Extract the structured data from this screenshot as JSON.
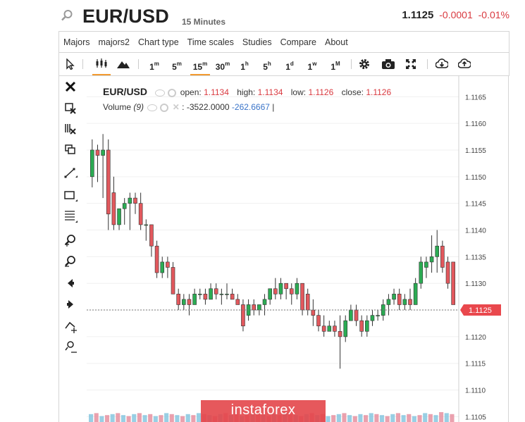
{
  "header": {
    "symbol": "EUR/USD",
    "interval": "15 Minutes",
    "price": "1.1125",
    "change": "-0.0001",
    "change_pct": "-0.01%"
  },
  "menu": [
    "Majors",
    "majors2",
    "Chart type",
    "Time scales",
    "Studies",
    "Compare",
    "About"
  ],
  "toolbar": {
    "periods": [
      {
        "n": "1",
        "u": "m",
        "active": false
      },
      {
        "n": "5",
        "u": "m",
        "active": false
      },
      {
        "n": "15",
        "u": "m",
        "active": true
      },
      {
        "n": "30",
        "u": "m",
        "active": false
      },
      {
        "n": "1",
        "u": "h",
        "active": false
      },
      {
        "n": "5",
        "u": "h",
        "active": false
      },
      {
        "n": "1",
        "u": "d",
        "active": false
      },
      {
        "n": "1",
        "u": "w",
        "active": false
      },
      {
        "n": "1",
        "u": "M",
        "active": false
      }
    ],
    "icons": [
      "cursor-icon",
      "candlestick-icon",
      "mountain-icon",
      "gear-icon",
      "camera-icon",
      "fullscreen-icon",
      "download-icon",
      "upload-icon"
    ]
  },
  "sidebar_icons": [
    "close-icon",
    "delete-drawing-icon",
    "delete-all-icon",
    "clone-icon",
    "trendline-icon",
    "rectangle-icon",
    "fib-icon",
    "zoom-in-icon",
    "zoom-out-icon",
    "scroll-left-icon",
    "scroll-right-icon",
    "magnet-down-icon",
    "magnet-up-icon"
  ],
  "legend": {
    "symbol": "EUR/USD",
    "open_label": "open:",
    "open": "1.1134",
    "high_label": "high:",
    "high": "1.1134",
    "low_label": "low:",
    "low": "1.1126",
    "close_label": "close:",
    "close": "1.1126",
    "volume_label": "Volume",
    "volume_param": "(9)",
    "volume_sep": ":",
    "volume_val1": "-3522.0000",
    "volume_val2": "-262.6667",
    "volume_cursor": "|"
  },
  "watermark": "instaforex",
  "colors": {
    "up": "#2bab53",
    "down": "#e2585d",
    "last": "#e9484d"
  },
  "chart_data": {
    "type": "candlestick",
    "y_ticks": [
      "1.1165",
      "1.1160",
      "1.1155",
      "1.1150",
      "1.1145",
      "1.1140",
      "1.1135",
      "1.1130",
      "1.1125",
      "1.1120",
      "1.1115",
      "1.1110",
      "1.1105"
    ],
    "ylim": [
      1.1104,
      1.1169
    ],
    "last_price": "1.1125",
    "grid": true,
    "candles": [
      {
        "o": 1.115,
        "h": 1.1157,
        "l": 1.1148,
        "c": 1.1155
      },
      {
        "o": 1.1155,
        "h": 1.1156,
        "l": 1.1149,
        "c": 1.1154
      },
      {
        "o": 1.1154,
        "h": 1.1158,
        "l": 1.1146,
        "c": 1.1155
      },
      {
        "o": 1.1155,
        "h": 1.1157,
        "l": 1.114,
        "c": 1.1143
      },
      {
        "o": 1.1147,
        "h": 1.115,
        "l": 1.114,
        "c": 1.1141
      },
      {
        "o": 1.1141,
        "h": 1.1144,
        "l": 1.114,
        "c": 1.1144
      },
      {
        "o": 1.1144,
        "h": 1.1146,
        "l": 1.1141,
        "c": 1.1145
      },
      {
        "o": 1.1145,
        "h": 1.1147,
        "l": 1.114,
        "c": 1.1146
      },
      {
        "o": 1.1146,
        "h": 1.1147,
        "l": 1.1143,
        "c": 1.1145
      },
      {
        "o": 1.1145,
        "h": 1.1147,
        "l": 1.114,
        "c": 1.1141
      },
      {
        "o": 1.1141,
        "h": 1.1142,
        "l": 1.1138,
        "c": 1.1141
      },
      {
        "o": 1.1141,
        "h": 1.1141,
        "l": 1.1135,
        "c": 1.1137
      },
      {
        "o": 1.1137,
        "h": 1.1138,
        "l": 1.1131,
        "c": 1.1132
      },
      {
        "o": 1.1132,
        "h": 1.1135,
        "l": 1.1131,
        "c": 1.1134
      },
      {
        "o": 1.1134,
        "h": 1.1135,
        "l": 1.1131,
        "c": 1.1133
      },
      {
        "o": 1.1133,
        "h": 1.1134,
        "l": 1.1128,
        "c": 1.1128
      },
      {
        "o": 1.1128,
        "h": 1.1129,
        "l": 1.1125,
        "c": 1.1126
      },
      {
        "o": 1.1126,
        "h": 1.1128,
        "l": 1.1125,
        "c": 1.1127
      },
      {
        "o": 1.1127,
        "h": 1.1128,
        "l": 1.1124,
        "c": 1.1126
      },
      {
        "o": 1.1126,
        "h": 1.1129,
        "l": 1.1126,
        "c": 1.1128
      },
      {
        "o": 1.1128,
        "h": 1.1129,
        "l": 1.1127,
        "c": 1.1128
      },
      {
        "o": 1.1128,
        "h": 1.1129,
        "l": 1.1126,
        "c": 1.1127
      },
      {
        "o": 1.1127,
        "h": 1.113,
        "l": 1.1127,
        "c": 1.1129
      },
      {
        "o": 1.1129,
        "h": 1.113,
        "l": 1.1127,
        "c": 1.1128
      },
      {
        "o": 1.1128,
        "h": 1.1129,
        "l": 1.1126,
        "c": 1.1128
      },
      {
        "o": 1.1128,
        "h": 1.113,
        "l": 1.1127,
        "c": 1.1128
      },
      {
        "o": 1.1128,
        "h": 1.1129,
        "l": 1.1127,
        "c": 1.1127
      },
      {
        "o": 1.1127,
        "h": 1.1128,
        "l": 1.1126,
        "c": 1.1126
      },
      {
        "o": 1.1126,
        "h": 1.1127,
        "l": 1.1121,
        "c": 1.1122
      },
      {
        "o": 1.1124,
        "h": 1.1127,
        "l": 1.1123,
        "c": 1.1126
      },
      {
        "o": 1.1126,
        "h": 1.1127,
        "l": 1.1124,
        "c": 1.1125
      },
      {
        "o": 1.1125,
        "h": 1.1126,
        "l": 1.1124,
        "c": 1.1126
      },
      {
        "o": 1.1126,
        "h": 1.1128,
        "l": 1.1124,
        "c": 1.1127
      },
      {
        "o": 1.1127,
        "h": 1.1129,
        "l": 1.1126,
        "c": 1.1129
      },
      {
        "o": 1.1129,
        "h": 1.1131,
        "l": 1.1127,
        "c": 1.1128
      },
      {
        "o": 1.1128,
        "h": 1.1131,
        "l": 1.1127,
        "c": 1.113
      },
      {
        "o": 1.113,
        "h": 1.113,
        "l": 1.1127,
        "c": 1.1129
      },
      {
        "o": 1.1129,
        "h": 1.113,
        "l": 1.1126,
        "c": 1.1128
      },
      {
        "o": 1.1128,
        "h": 1.1131,
        "l": 1.1127,
        "c": 1.113
      },
      {
        "o": 1.113,
        "h": 1.113,
        "l": 1.1124,
        "c": 1.1125
      },
      {
        "o": 1.1128,
        "h": 1.1129,
        "l": 1.1124,
        "c": 1.1125
      },
      {
        "o": 1.1125,
        "h": 1.1127,
        "l": 1.1122,
        "c": 1.1124
      },
      {
        "o": 1.1124,
        "h": 1.1125,
        "l": 1.1121,
        "c": 1.1122
      },
      {
        "o": 1.1122,
        "h": 1.1124,
        "l": 1.112,
        "c": 1.1121
      },
      {
        "o": 1.1121,
        "h": 1.1123,
        "l": 1.1121,
        "c": 1.1122
      },
      {
        "o": 1.1122,
        "h": 1.1123,
        "l": 1.112,
        "c": 1.1121
      },
      {
        "o": 1.1121,
        "h": 1.1124,
        "l": 1.1114,
        "c": 1.112
      },
      {
        "o": 1.112,
        "h": 1.1124,
        "l": 1.1119,
        "c": 1.1123
      },
      {
        "o": 1.1123,
        "h": 1.1126,
        "l": 1.1123,
        "c": 1.1125
      },
      {
        "o": 1.1125,
        "h": 1.1126,
        "l": 1.1122,
        "c": 1.1123
      },
      {
        "o": 1.1123,
        "h": 1.1124,
        "l": 1.112,
        "c": 1.1121
      },
      {
        "o": 1.1121,
        "h": 1.1124,
        "l": 1.112,
        "c": 1.1123
      },
      {
        "o": 1.1123,
        "h": 1.1125,
        "l": 1.1122,
        "c": 1.1124
      },
      {
        "o": 1.1124,
        "h": 1.1125,
        "l": 1.1123,
        "c": 1.1124
      },
      {
        "o": 1.1124,
        "h": 1.1127,
        "l": 1.1123,
        "c": 1.1126
      },
      {
        "o": 1.1126,
        "h": 1.1128,
        "l": 1.1124,
        "c": 1.1127
      },
      {
        "o": 1.1127,
        "h": 1.1129,
        "l": 1.1126,
        "c": 1.1128
      },
      {
        "o": 1.1128,
        "h": 1.1129,
        "l": 1.1125,
        "c": 1.1126
      },
      {
        "o": 1.1126,
        "h": 1.1128,
        "l": 1.1125,
        "c": 1.1127
      },
      {
        "o": 1.1127,
        "h": 1.1129,
        "l": 1.1125,
        "c": 1.1126
      },
      {
        "o": 1.1126,
        "h": 1.1131,
        "l": 1.1126,
        "c": 1.113
      },
      {
        "o": 1.113,
        "h": 1.1135,
        "l": 1.1129,
        "c": 1.1134
      },
      {
        "o": 1.1133,
        "h": 1.1135,
        "l": 1.1131,
        "c": 1.1134
      },
      {
        "o": 1.1134,
        "h": 1.1139,
        "l": 1.1132,
        "c": 1.1135
      },
      {
        "o": 1.1135,
        "h": 1.114,
        "l": 1.1132,
        "c": 1.1137
      },
      {
        "o": 1.1137,
        "h": 1.1138,
        "l": 1.1132,
        "c": 1.1133
      },
      {
        "o": 1.1134,
        "h": 1.1135,
        "l": 1.1129,
        "c": 1.113
      },
      {
        "o": 1.1134,
        "h": 1.1134,
        "l": 1.1126,
        "c": 1.1126
      }
    ],
    "volume": [
      8,
      9,
      6,
      7,
      8,
      9,
      7,
      6,
      8,
      9,
      7,
      8,
      6,
      7,
      9,
      8,
      7,
      6,
      8,
      7,
      9,
      8,
      7,
      6,
      8,
      9,
      7,
      8,
      6,
      7,
      8,
      9,
      7,
      6,
      8,
      7,
      9,
      8,
      7,
      6,
      8,
      9,
      7,
      8,
      6,
      7,
      8,
      9,
      7,
      6,
      8,
      7,
      9,
      8,
      7,
      6,
      8,
      9,
      7,
      8,
      6,
      7,
      9,
      8,
      7,
      10,
      9,
      8
    ]
  }
}
